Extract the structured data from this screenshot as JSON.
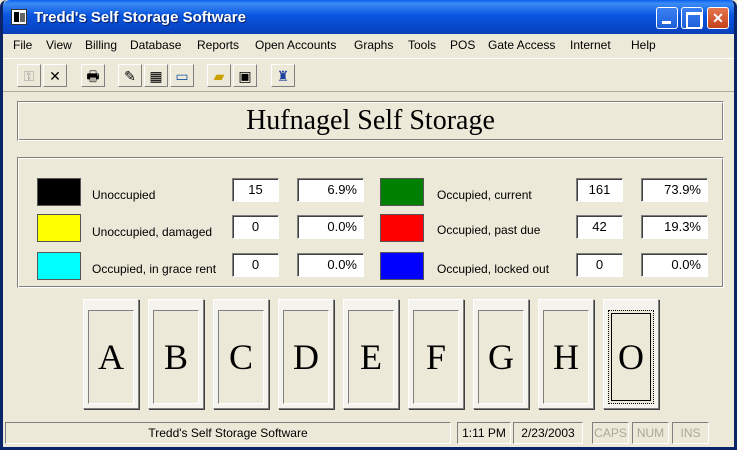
{
  "window": {
    "title": "Tredd's Self Storage Software"
  },
  "menu": [
    "File",
    "View",
    "Billing",
    "Database",
    "Reports",
    "Open Accounts",
    "Graphs",
    "Tools",
    "POS",
    "Gate Access",
    "Internet",
    "Help"
  ],
  "toolbar": {
    "icons": [
      "key-icon",
      "close-x-icon",
      "printer-icon",
      "notes-icon",
      "calculator-icon",
      "keyboard-icon",
      "open-folder-icon",
      "save-disk-icon",
      "wizard-icon"
    ]
  },
  "facility": {
    "name": "Hufnagel Self Storage"
  },
  "status_left": [
    {
      "label": "Unoccupied",
      "count": "15",
      "percent": "6.9%",
      "color": "#000000"
    },
    {
      "label": "Unoccupied, damaged",
      "count": "0",
      "percent": "0.0%",
      "color": "#FFFF00"
    },
    {
      "label": "Occupied, in grace rent",
      "count": "0",
      "percent": "0.0%",
      "color": "#00FFFF"
    }
  ],
  "status_right": [
    {
      "label": "Occupied, current",
      "count": "161",
      "percent": "73.9%",
      "color": "#008000"
    },
    {
      "label": "Occupied, past due",
      "count": "42",
      "percent": "19.3%",
      "color": "#FF0000"
    },
    {
      "label": "Occupied, locked out",
      "count": "0",
      "percent": "0.0%",
      "color": "#0000FF"
    }
  ],
  "buildings": [
    "A",
    "B",
    "C",
    "D",
    "E",
    "F",
    "G",
    "H",
    "O"
  ],
  "statusbar": {
    "app": "Tredd's Self Storage Software",
    "time": "1:11 PM",
    "date": "2/23/2003",
    "caps": "CAPS",
    "num": "NUM",
    "ins": "INS"
  }
}
